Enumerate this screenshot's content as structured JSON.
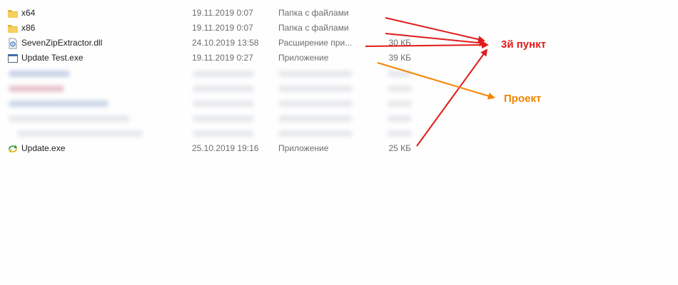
{
  "files": [
    {
      "name": "x64",
      "date": "19.11.2019 0:07",
      "type": "Папка с файлами",
      "size": "",
      "icon": "folder-icon"
    },
    {
      "name": "x86",
      "date": "19.11.2019 0:07",
      "type": "Папка с файлами",
      "size": "",
      "icon": "folder-icon"
    },
    {
      "name": "SevenZipExtractor.dll",
      "date": "24.10.2019 13:58",
      "type": "Расширение при...",
      "size": "30 КБ",
      "icon": "dll-icon"
    },
    {
      "name": "Update Test.exe",
      "date": "19.11.2019 0:27",
      "type": "Приложение",
      "size": "39 КБ",
      "icon": "app-window-icon"
    },
    {
      "name": "Update.exe",
      "date": "25.10.2019 19:16",
      "type": "Приложение",
      "size": "25 КБ",
      "icon": "update-app-icon"
    }
  ],
  "annotations": {
    "item3": "3й пункт",
    "project": "Проект"
  },
  "colors": {
    "red_annotation": "#e01b1b",
    "orange_annotation": "#f38400",
    "folder": "#e8b93a",
    "secondary_text": "#6d6d6d"
  }
}
